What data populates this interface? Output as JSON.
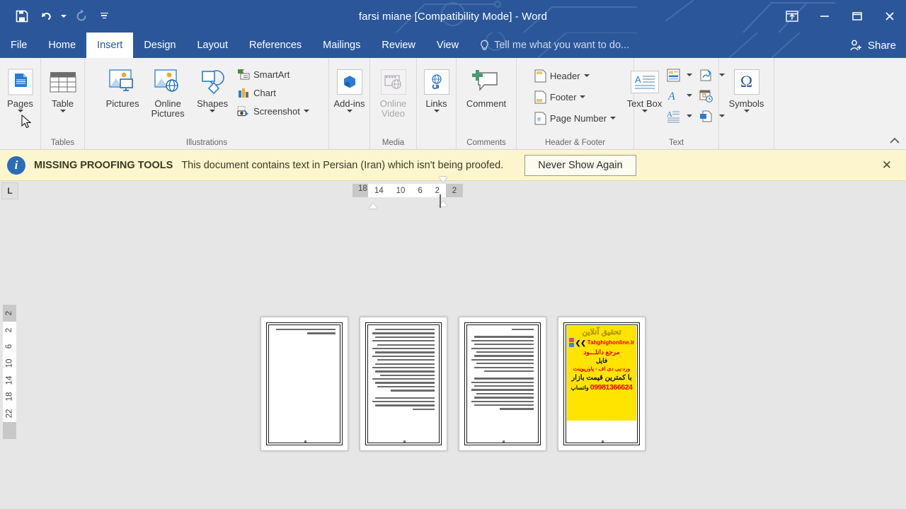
{
  "titlebar": {
    "title": "farsi miane [Compatibility Mode] - Word",
    "qat": [
      {
        "name": "save-button",
        "icon": "save-icon",
        "label": "Save"
      },
      {
        "name": "undo-button",
        "icon": "undo-icon",
        "label": "Undo"
      },
      {
        "name": "redo-button",
        "icon": "redo-icon",
        "label": "Repeat",
        "disabled": true
      },
      {
        "name": "customize-quick-access-toolbar",
        "icon": "chevron-down-icon",
        "label": "Customize Quick Access Toolbar"
      }
    ],
    "window_controls": [
      {
        "name": "ribbon-display-options-button",
        "icon": "ribbon-display-options-icon",
        "label": "Ribbon Display Options"
      },
      {
        "name": "minimize-button",
        "icon": "minimize-icon",
        "label": "Minimize"
      },
      {
        "name": "restore-button",
        "icon": "restore-icon",
        "label": "Restore Down"
      },
      {
        "name": "close-button",
        "icon": "close-icon",
        "label": "Close"
      }
    ]
  },
  "tabs": [
    {
      "label": "File",
      "active": false
    },
    {
      "label": "Home",
      "active": false
    },
    {
      "label": "Insert",
      "active": true
    },
    {
      "label": "Design",
      "active": false
    },
    {
      "label": "Layout",
      "active": false
    },
    {
      "label": "References",
      "active": false
    },
    {
      "label": "Mailings",
      "active": false
    },
    {
      "label": "Review",
      "active": false
    },
    {
      "label": "View",
      "active": false
    }
  ],
  "tell_me": {
    "placeholder": "Tell me what you want to do...",
    "icon": "lightbulb-icon"
  },
  "share": {
    "label": "Share",
    "icon": "share-person-icon"
  },
  "ribbon": {
    "groups": {
      "pages": {
        "label": "",
        "button": {
          "label": "Pages",
          "icon": "pages-icon"
        }
      },
      "tables": {
        "label": "Tables",
        "button": {
          "label": "Table",
          "icon": "table-icon"
        }
      },
      "illustrations": {
        "label": "Illustrations",
        "big": [
          {
            "label": "Pictures",
            "icon": "pictures-icon"
          },
          {
            "label": "Online Pictures",
            "icon": "online-pictures-icon"
          },
          {
            "label": "Shapes",
            "icon": "shapes-icon"
          }
        ],
        "small": [
          {
            "label": "SmartArt",
            "icon": "smartart-icon"
          },
          {
            "label": "Chart",
            "icon": "chart-icon"
          },
          {
            "label": "Screenshot",
            "icon": "screenshot-icon"
          }
        ]
      },
      "addins": {
        "label": "",
        "button": {
          "label": "Add-ins",
          "icon": "addins-icon"
        }
      },
      "media": {
        "label": "Media",
        "button": {
          "label": "Online Video",
          "icon": "online-video-icon",
          "disabled": true
        }
      },
      "links": {
        "label": "",
        "button": {
          "label": "Links",
          "icon": "links-icon"
        }
      },
      "comments": {
        "label": "Comments",
        "button": {
          "label": "Comment",
          "icon": "comment-icon"
        }
      },
      "header_footer": {
        "label": "Header & Footer",
        "items": [
          {
            "label": "Header",
            "icon": "header-icon"
          },
          {
            "label": "Footer",
            "icon": "footer-icon"
          },
          {
            "label": "Page Number",
            "icon": "page-number-icon"
          }
        ]
      },
      "text": {
        "label": "Text",
        "big": {
          "label": "Text Box",
          "icon": "text-box-icon"
        },
        "mini": [
          {
            "name": "quick-parts",
            "icon": "quick-parts-icon"
          },
          {
            "name": "signature-line",
            "icon": "signature-line-icon"
          },
          {
            "name": "wordart",
            "icon": "wordart-icon"
          },
          {
            "name": "date-and-time",
            "icon": "date-time-icon"
          },
          {
            "name": "drop-cap",
            "icon": "drop-cap-icon"
          },
          {
            "name": "object",
            "icon": "object-icon"
          }
        ]
      },
      "symbols": {
        "label": "",
        "button": {
          "label": "Symbols",
          "icon": "omega-icon",
          "glyph": "Ω"
        }
      }
    },
    "collapse": {
      "label": "Collapse the Ribbon",
      "icon": "chevron-up-icon"
    }
  },
  "infobar": {
    "icon": "info-icon",
    "title": "MISSING PROOFING TOOLS",
    "message": "This document contains text in Persian (Iran) which isn't being proofed.",
    "button": "Never Show Again",
    "close": "✕"
  },
  "ruler": {
    "tab_stop_marker": "L",
    "horizontal_numbers": [
      "18",
      "14",
      "10",
      "6",
      "2",
      "2"
    ],
    "vertical_numbers": [
      "2",
      "2",
      "6",
      "10",
      "14",
      "18",
      "22"
    ]
  },
  "document": {
    "pages": [
      {
        "number": 1,
        "type": "text",
        "heading": false
      },
      {
        "number": 2,
        "type": "text",
        "heading": false
      },
      {
        "number": 3,
        "type": "text",
        "heading": true
      },
      {
        "number": 4,
        "type": "ad"
      }
    ],
    "ad": {
      "line1": "تحقیق آنلاین",
      "site": "Tahghighonline.ir",
      "line3": "مرجع دانلـــود",
      "line4": "فایل",
      "line5": "ورد-پی دی اف - پاورپوینت",
      "line6": "با کمترین قیمت بازار",
      "phone": "09981366624",
      "whatsapp": "واتساپ",
      "bg_color": "#ffe400",
      "accent_color": "#e8000d"
    }
  },
  "colors": {
    "brand": "#2b579a",
    "ribbon_bg": "#f1f1f1",
    "workspace_bg": "#e6e6e6",
    "infobar_bg": "#fdf5ce"
  }
}
